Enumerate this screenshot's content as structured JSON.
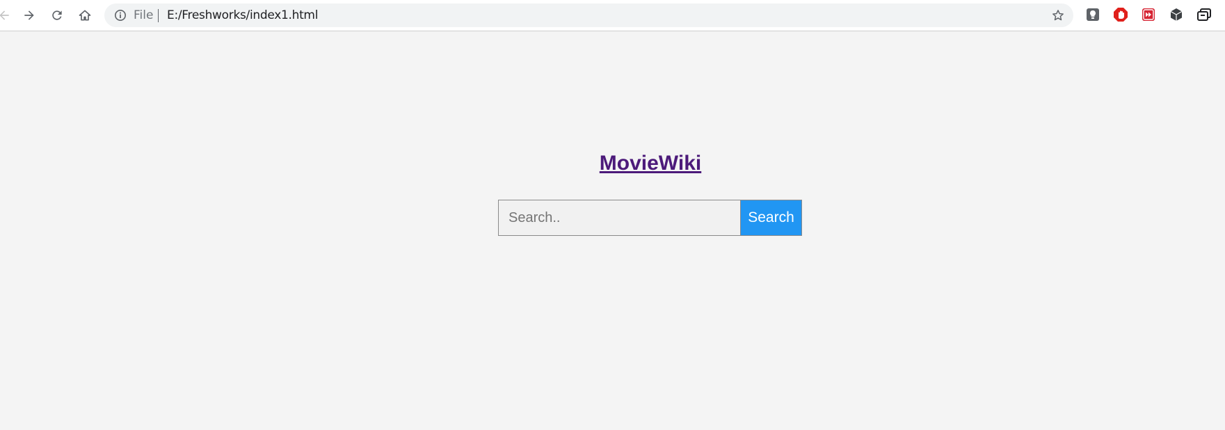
{
  "browser": {
    "address_bar": {
      "scheme_label": "File",
      "url": "E:/Freshworks/index1.html"
    },
    "nav_icons": [
      "back-arrow-icon",
      "forward-arrow-icon",
      "reload-icon",
      "home-icon"
    ],
    "extension_icons": [
      "lightbulb-extension-icon",
      "adblock-extension-icon",
      "media-extension-icon",
      "cube-extension-icon",
      "window-extension-icon"
    ]
  },
  "page": {
    "title": "MovieWiki",
    "search": {
      "placeholder": "Search..",
      "value": "",
      "button_label": "Search"
    }
  },
  "colors": {
    "page_background": "#f4f4f4",
    "title_link": "#4c1a7a",
    "search_button": "#2196f3"
  }
}
